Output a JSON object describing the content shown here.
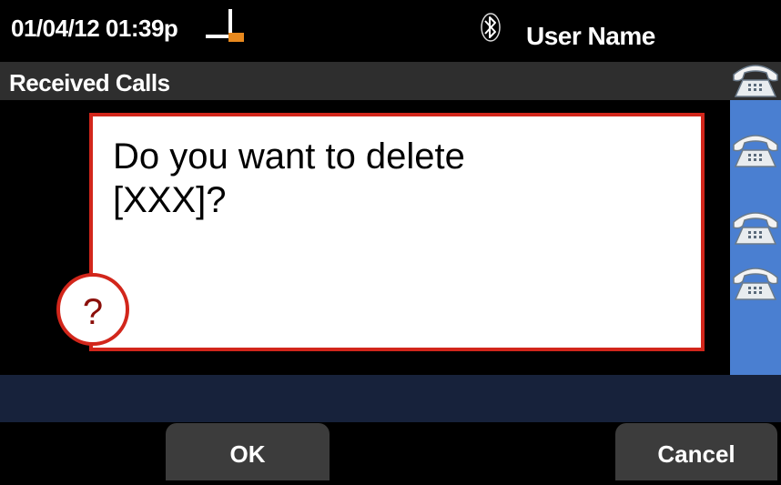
{
  "status_bar": {
    "datetime": "01/04/12 01:39p",
    "signal_icon": "call-line-indicator-icon",
    "bluetooth_icon": "bluetooth-icon",
    "user_name": "User Name"
  },
  "header": {
    "title": "Received Calls"
  },
  "line_buttons": [
    {
      "icon": "phone-handset-icon"
    },
    {
      "icon": "phone-handset-icon"
    },
    {
      "icon": "phone-handset-icon"
    },
    {
      "icon": "phone-handset-icon"
    }
  ],
  "dialog": {
    "line1": "Do you want to delete",
    "line2": "[XXX]?",
    "badge": "?",
    "badge_icon": "question-icon"
  },
  "softkeys": {
    "ok": "OK",
    "cancel": "Cancel"
  },
  "colors": {
    "accent_red": "#d2261b",
    "line_panel_blue": "#4a7fd1",
    "header_gray": "#2e2e2e",
    "bottom_strip": "#17223b",
    "softkey_gray": "#3c3c3c",
    "signal_orange": "#e8891e"
  }
}
